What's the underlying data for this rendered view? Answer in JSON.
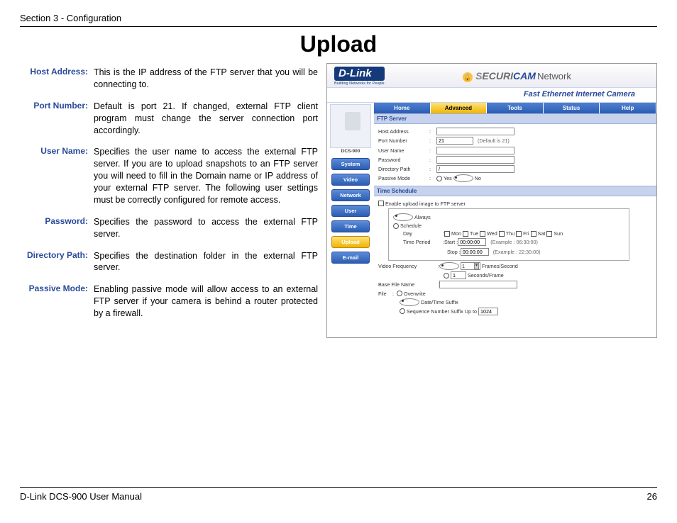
{
  "header": {
    "section": "Section 3 - Configuration",
    "title": "Upload"
  },
  "definitions": {
    "host_address": {
      "label": "Host Address:",
      "text": "This is the IP address of the FTP server that you will be connecting to."
    },
    "port_number": {
      "label": "Port Number:",
      "text": "Default is port 21. If changed, external FTP client program must change the server connection port accordingly."
    },
    "user_name": {
      "label": "User Name:",
      "text": "Specifies the user name to access the external FTP server. If you are to upload snapshots to an FTP server you will need to fill in the Domain name or IP address of your external FTP server. The following user settings must be correctly configured for remote access."
    },
    "password": {
      "label": "Password:",
      "text": "Specifies the password to access the external FTP server."
    },
    "directory_path": {
      "label": "Directory Path:",
      "text": "Specifies the destination folder in the external FTP server."
    },
    "passive_mode": {
      "label": "Passive Mode:",
      "text": "Enabling passive mode will allow access to an external FTP server if your camera is behind a router protected by a firewall."
    }
  },
  "screenshot": {
    "brand": {
      "logo": "D-Link",
      "sub": "Building Networks for People",
      "product_line": "SECURICAM",
      "net": "Network",
      "subtitle": "Fast Ethernet Internet Camera",
      "model": "DCS-900"
    },
    "tabs": {
      "home": "Home",
      "advanced": "Advanced",
      "tools": "Tools",
      "status": "Status",
      "help": "Help"
    },
    "sidebar": {
      "system": "System",
      "video": "Video",
      "network": "Network",
      "user": "User",
      "time": "Time",
      "upload": "Upload",
      "email": "E-mail"
    },
    "ftp": {
      "title": "FTP Server",
      "host": "Host Address",
      "host_val": "",
      "port": "Port Number",
      "port_val": "21",
      "port_hint": "(Default is 21)",
      "user": "User Name",
      "user_val": "",
      "pass": "Password",
      "pass_val": "",
      "dir": "Directory Path",
      "dir_val": "/",
      "passive": "Passive Mode",
      "yes": "Yes",
      "no": "No"
    },
    "schedule": {
      "title": "Time Schedule",
      "enable": "Enable upload image to FTP server",
      "always": "Always",
      "schedule": "Schedule",
      "day": "Day",
      "mon": "Mon",
      "tue": "Tue",
      "wed": "Wed",
      "thu": "Thu",
      "fri": "Fri",
      "sat": "Sat",
      "sun": "Sun",
      "time_period": "Time Period",
      "start": "Start :",
      "start_val": "00:00:00",
      "start_ex": "(Example : 06:30:00)",
      "stop": "Stop :",
      "stop_val": "00:00:00",
      "stop_ex": "(Example : 22:30:00)",
      "video_freq": "Video Frequency",
      "vf_val": "1",
      "fps": "Frames/Second",
      "spf": "Seconds/Frame",
      "spf_val": "1",
      "basefile": "Base File Name",
      "basefile_val": "",
      "file": "File",
      "overwrite": "Overwrite",
      "datetime": "Date/Time Suffix",
      "seq": "Sequence Number Suffix Up to",
      "seq_val": "1024"
    }
  },
  "footer": {
    "manual": "D-Link DCS-900 User Manual",
    "page": "26"
  }
}
